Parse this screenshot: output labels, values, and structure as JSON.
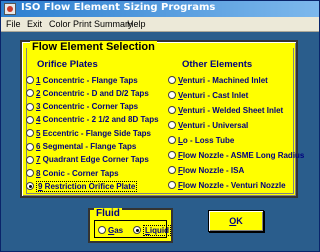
{
  "window": {
    "title": "ISO Flow Element Sizing Programs"
  },
  "menu": [
    "File",
    "Exit",
    "Color",
    "Print Summary",
    "Help"
  ],
  "panel": {
    "title": "Flow Element Selection",
    "orifice_title": "Orifice Plates",
    "other_title": "Other Elements",
    "orifice": [
      {
        "num": "1",
        "text": " Concentric - Flange Taps",
        "checked": false
      },
      {
        "num": "2",
        "text": " Concentric - D and D/2 Taps",
        "checked": false
      },
      {
        "num": "3",
        "text": " Concentric - Corner Taps",
        "checked": false
      },
      {
        "num": "4",
        "text": " Concentric - 2 1/2 and 8D Taps",
        "checked": false
      },
      {
        "num": "5",
        "text": " Eccentric - Flange Side Taps",
        "checked": false
      },
      {
        "num": "6",
        "text": " Segmental - Flange Taps",
        "checked": false
      },
      {
        "num": "7",
        "text": " Quadrant Edge Corner Taps",
        "checked": false
      },
      {
        "num": "8",
        "text": " Conic - Corner Taps",
        "checked": false
      },
      {
        "num": "9",
        "text": " Restriction Orifice Plate",
        "checked": true
      }
    ],
    "other": [
      {
        "u": "V",
        "text": "enturi - Machined Inlet"
      },
      {
        "u": "V",
        "text": "enturi - Cast Inlet"
      },
      {
        "u": "V",
        "text": "enturi - Welded Sheet Inlet"
      },
      {
        "u": "V",
        "text": "enturi - Universal"
      },
      {
        "u": "L",
        "text": "o - Loss Tube"
      },
      {
        "u": "F",
        "text": "low Nozzle - ASME Long Radius"
      },
      {
        "u": "F",
        "text": "low Nozzle - ISA"
      },
      {
        "u": "F",
        "text": "low Nozzle - Venturi Nozzle"
      }
    ]
  },
  "fluid": {
    "title": "Fluid",
    "gas_u": "G",
    "gas_rest": "as",
    "liquid_u": "L",
    "liquid_rest": "iquid",
    "selected": "liquid"
  },
  "ok": {
    "u": "O",
    "rest": "K"
  }
}
